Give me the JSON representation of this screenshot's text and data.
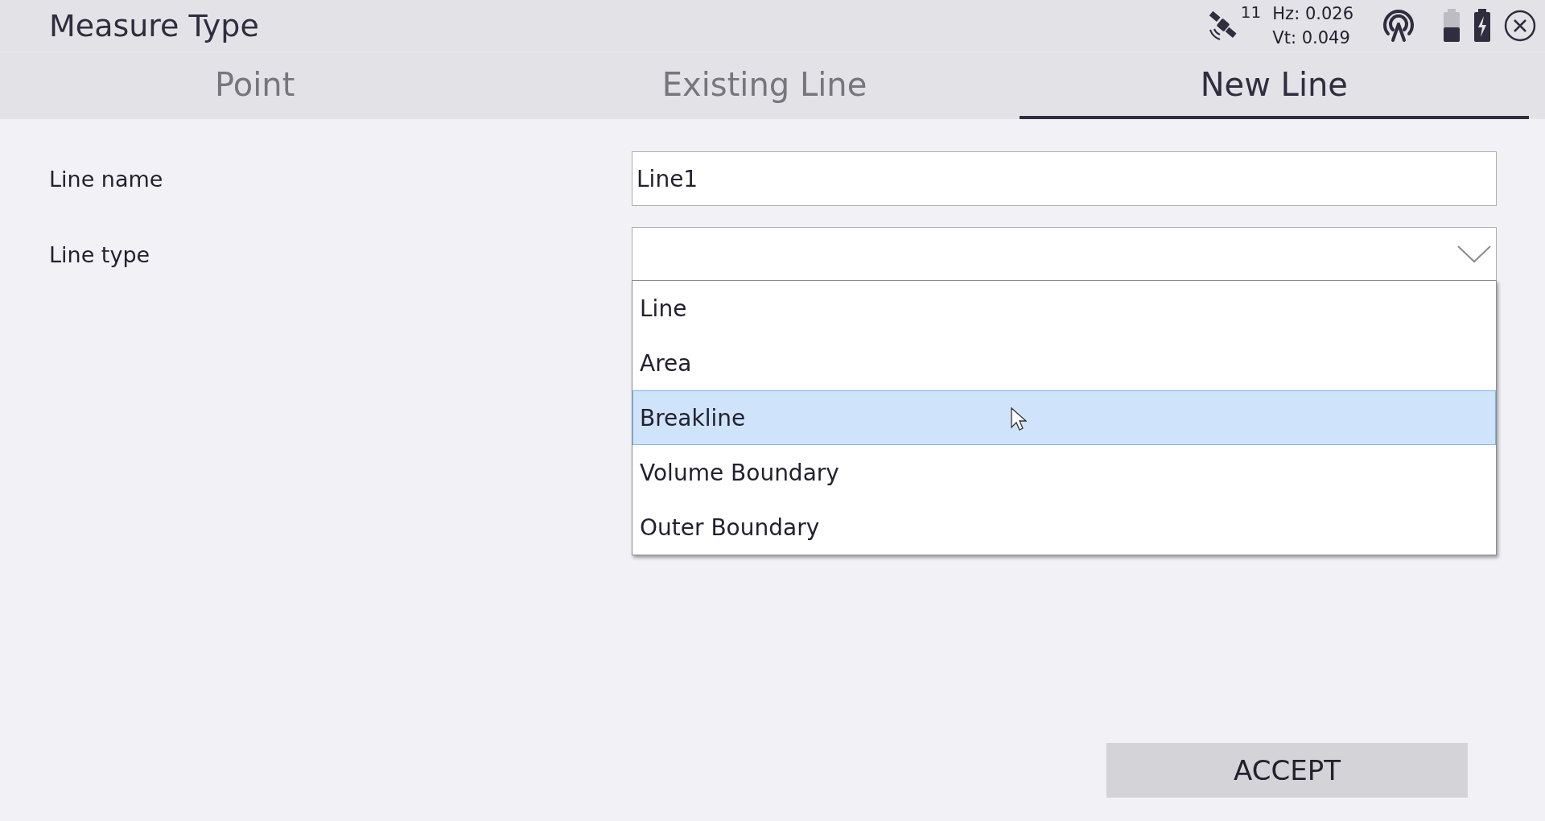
{
  "window": {
    "title": "Measure Type"
  },
  "status": {
    "satellites": "11",
    "hz": "Hz: 0.026",
    "vt": "Vt: 0.049"
  },
  "tabs": [
    {
      "label": "Point",
      "selected": false
    },
    {
      "label": "Existing Line",
      "selected": false
    },
    {
      "label": "New Line",
      "selected": true
    }
  ],
  "form": {
    "line_name": {
      "label": "Line name",
      "value": "Line1"
    },
    "line_type": {
      "label": "Line type",
      "expanded": true,
      "options": [
        {
          "label": "Line",
          "selected": false
        },
        {
          "label": "Area",
          "selected": false
        },
        {
          "label": "Breakline",
          "selected": true
        },
        {
          "label": "Volume Boundary",
          "selected": false
        },
        {
          "label": "Outer Boundary",
          "selected": false
        }
      ]
    }
  },
  "buttons": [
    "ACCEPT"
  ]
}
